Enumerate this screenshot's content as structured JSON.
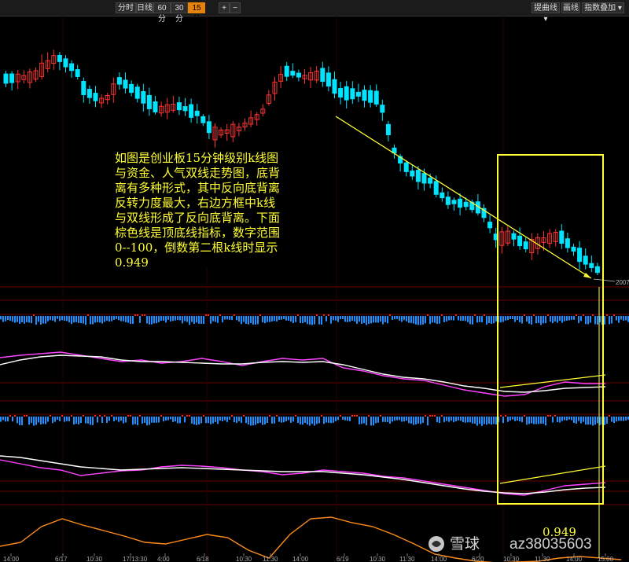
{
  "toolbar": {
    "periods": [
      "分时",
      "日线",
      "60分",
      "30分",
      "15分"
    ],
    "active_period": "15分",
    "plus": "+",
    "minus": "−",
    "right_buttons": [
      "提曲线 ▾",
      "画线",
      "指数叠加 ▾"
    ]
  },
  "colors": {
    "up": "#ff3333",
    "down": "#00e5ff",
    "annotation": "#ffff33",
    "funds_line": "#ff44ff",
    "popularity_line": "#ffffff",
    "top_bottom_line": "#ff8c1a",
    "grid": "#6a0000"
  },
  "price_label": "2007",
  "annotation": {
    "lines": [
      "如图是创业板15分钟级别k线图",
      "与资金、人气双线走势图，底背",
      "离有多种形式，其中反向底背离",
      "反转力度最大，右边方框中k线",
      "与双线形成了反向底背离。下面",
      "棕色线是顶底线指标，数字范围",
      "0--100，倒数第二根k线时显示",
      "0.949"
    ],
    "value_label": "0.949"
  },
  "watermark": {
    "brand": "雪球",
    "user": "az38035603"
  },
  "time_axis": [
    "14:00",
    "6/17",
    "10:30",
    "17/13:30",
    "4:00",
    "6/18",
    "10:30",
    "11:30",
    "14:00",
    "6/19",
    "10:30",
    "11:30",
    "14:00",
    "6/20",
    "10:30",
    "11:30",
    "14:00",
    "15:00"
  ]
}
